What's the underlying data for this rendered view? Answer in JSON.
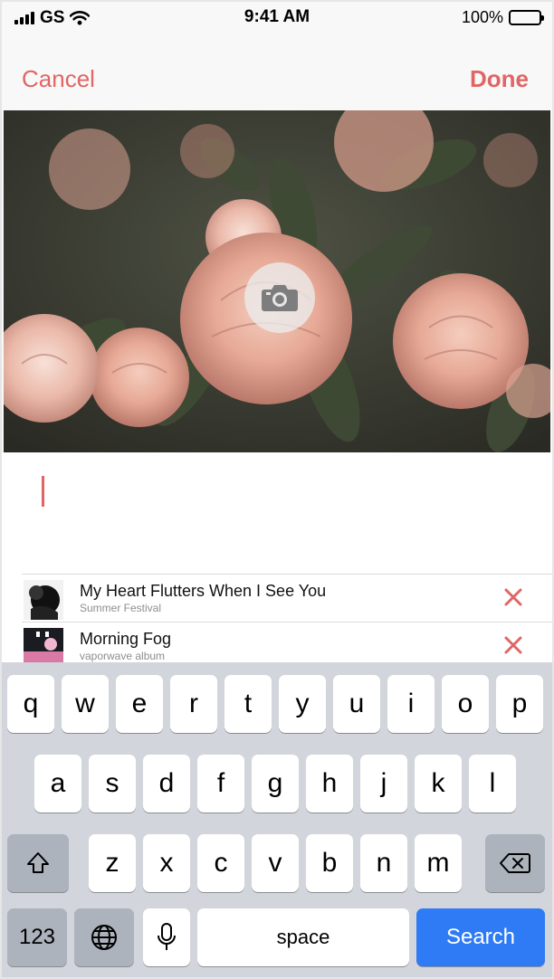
{
  "status_bar": {
    "carrier": "GS",
    "time": "9:41 AM",
    "battery": "100%"
  },
  "nav": {
    "cancel_label": "Cancel",
    "done_label": "Done"
  },
  "cover": {
    "image": "pink roses photo",
    "action_icon": "camera-icon"
  },
  "editor": {
    "value": "",
    "caret_color": "#e06565"
  },
  "tracks": [
    {
      "title": "My Heart Flutters When I See You",
      "subtitle": "Summer Festival",
      "action_icon": "close-icon"
    },
    {
      "title": "Morning Fog",
      "subtitle": "vaporwave album",
      "action_icon": "close-icon"
    }
  ],
  "keyboard": {
    "row1": [
      "q",
      "w",
      "e",
      "r",
      "t",
      "y",
      "u",
      "i",
      "o",
      "p"
    ],
    "row2": [
      "a",
      "s",
      "d",
      "f",
      "g",
      "h",
      "j",
      "k",
      "l"
    ],
    "row3": [
      "z",
      "x",
      "c",
      "v",
      "b",
      "n",
      "m"
    ],
    "shift_icon": "shift-icon",
    "delete_icon": "backspace-icon",
    "numbers_label": "123",
    "globe_icon": "globe-icon",
    "mic_icon": "microphone-icon",
    "space_label": "space",
    "search_label": "Search"
  },
  "colors": {
    "accent": "#e06565",
    "search_key": "#2f7bf6",
    "keyboard_bg": "#d2d5db"
  }
}
